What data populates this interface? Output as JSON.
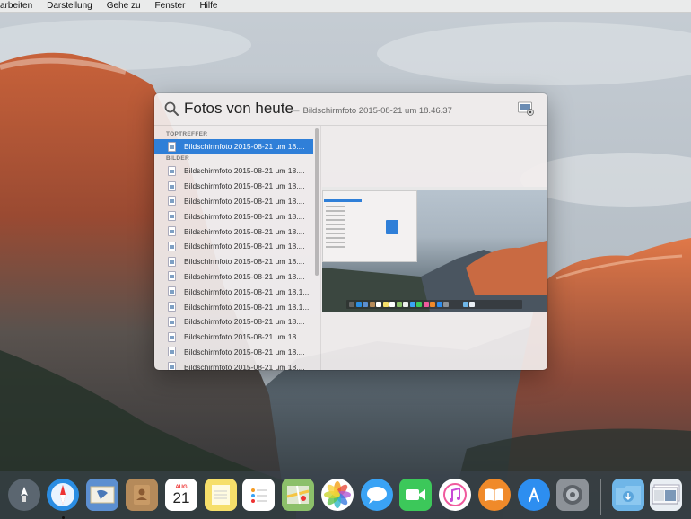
{
  "menubar": {
    "items": [
      "arbeiten",
      "Darstellung",
      "Gehe zu",
      "Fenster",
      "Hilfe"
    ]
  },
  "spotlight": {
    "query": "Fotos von heute",
    "hint": "Bildschirmfoto 2015-08-21 um 18.46.37",
    "sections": {
      "top_hits": "TOPTREFFER",
      "images": "BILDER"
    },
    "top_hit": "Bildschirmfoto 2015-08-21 um 18....",
    "image_results": [
      "Bildschirmfoto 2015-08-21 um 18....",
      "Bildschirmfoto 2015-08-21 um 18....",
      "Bildschirmfoto 2015-08-21 um 18....",
      "Bildschirmfoto 2015-08-21 um 18....",
      "Bildschirmfoto 2015-08-21 um 18....",
      "Bildschirmfoto 2015-08-21 um 18....",
      "Bildschirmfoto 2015-08-21 um 18....",
      "Bildschirmfoto 2015-08-21 um 18....",
      "Bildschirmfoto 2015-08-21 um 18.1...",
      "Bildschirmfoto 2015-08-21 um 18.1...",
      "Bildschirmfoto 2015-08-21 um 18....",
      "Bildschirmfoto 2015-08-21 um 18....",
      "Bildschirmfoto 2015-08-21 um 18....",
      "Bildschirmfoto 2015-08-21 um 18...."
    ]
  },
  "dock": {
    "calendar_month": "AUG",
    "calendar_day": "21",
    "icons": [
      {
        "name": "launchpad-icon",
        "color": "#5b6670"
      },
      {
        "name": "safari-icon",
        "color": "#2a8de3"
      },
      {
        "name": "mail-icon",
        "color": "#5c8fd1"
      },
      {
        "name": "contacts-icon",
        "color": "#b58a5a"
      },
      {
        "name": "calendar-icon",
        "color": "#ffffff"
      },
      {
        "name": "notes-icon",
        "color": "#f6df6a"
      },
      {
        "name": "reminders-icon",
        "color": "#ffffff"
      },
      {
        "name": "maps-icon",
        "color": "#8cc06a"
      },
      {
        "name": "photos-icon",
        "color": "#ffffff"
      },
      {
        "name": "messages-icon",
        "color": "#3aa3f5"
      },
      {
        "name": "facetime-icon",
        "color": "#3cc85a"
      },
      {
        "name": "itunes-icon",
        "color": "#f05a9d"
      },
      {
        "name": "ibooks-icon",
        "color": "#f08a2a"
      },
      {
        "name": "app-store-icon",
        "color": "#2d8ef0"
      },
      {
        "name": "system-preferences-icon",
        "color": "#8d9298"
      },
      {
        "name": "downloads-folder-icon",
        "color": "#6fb6e8"
      },
      {
        "name": "screenshot-stack-icon",
        "color": "#e9eef3"
      }
    ]
  }
}
